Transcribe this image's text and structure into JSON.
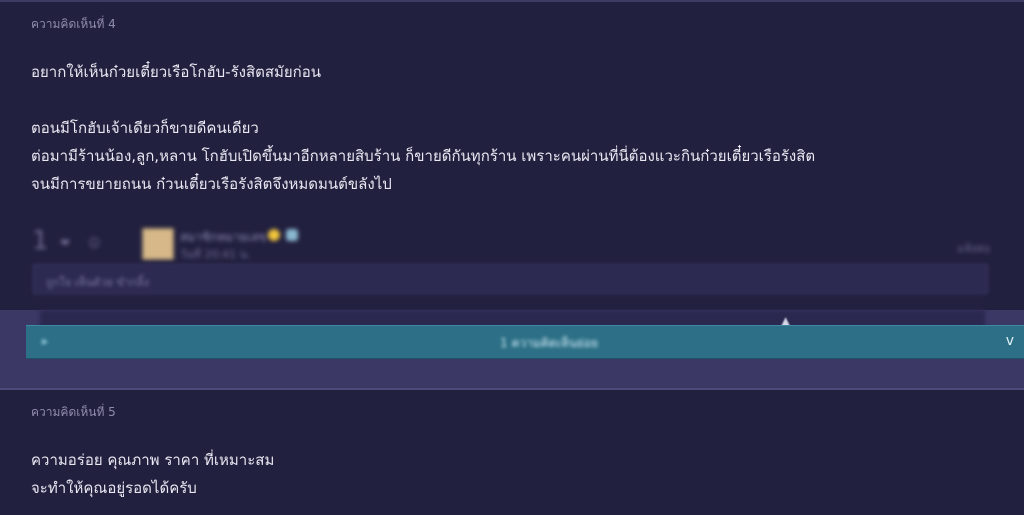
{
  "comments": [
    {
      "number_label": "ความคิดเห็นที่ 4",
      "lines": [
        "อยากให้เห็นก๋วยเตี๋ยวเรือโกฮับ-รังสิตสมัยก่อน",
        "",
        "ตอนมีโกฮับเจ้าเดียวก็ขายดีคนเดียว",
        "ต่อมามีร้านน้อง,ลูก,หลาน โกฮับเปิดขึ้นมาอีกหลายสิบร้าน ก็ขายดีกันทุกร้าน เพราะคนผ่านที่นี่ต้องแวะกินก๋วยเตี๋ยวเรือรังสิต",
        "จนมีการขยายถนน ก๋วนเตี๋ยวเรือรังสิตจึงหมดมนต์ขลังไป"
      ],
      "footer": {
        "vote_count": "1",
        "user_name": "สมาชิกหมายเลข",
        "post_time": "วันที่ 20:41 น.",
        "report_label": "แจ้งลบ",
        "emotion_text": "ถูกใจ เห็นด้วย ขำกลิ้ง"
      },
      "reply_bar": {
        "label": "1 ความคิดเห็นย่อย",
        "chevron": "v"
      }
    },
    {
      "number_label": "ความคิดเห็นที่ 5",
      "lines": [
        "ความอร่อย คุณภาพ ราคา ที่เหมาะสม",
        "จะทำให้คุณอยู่รอดได้ครับ"
      ]
    }
  ],
  "colors": {
    "background": "#22203f",
    "reply_bar": "#2c6f86",
    "sub_band": "#3b3865",
    "text": "#e9e8f2",
    "muted": "#8f8cad"
  }
}
